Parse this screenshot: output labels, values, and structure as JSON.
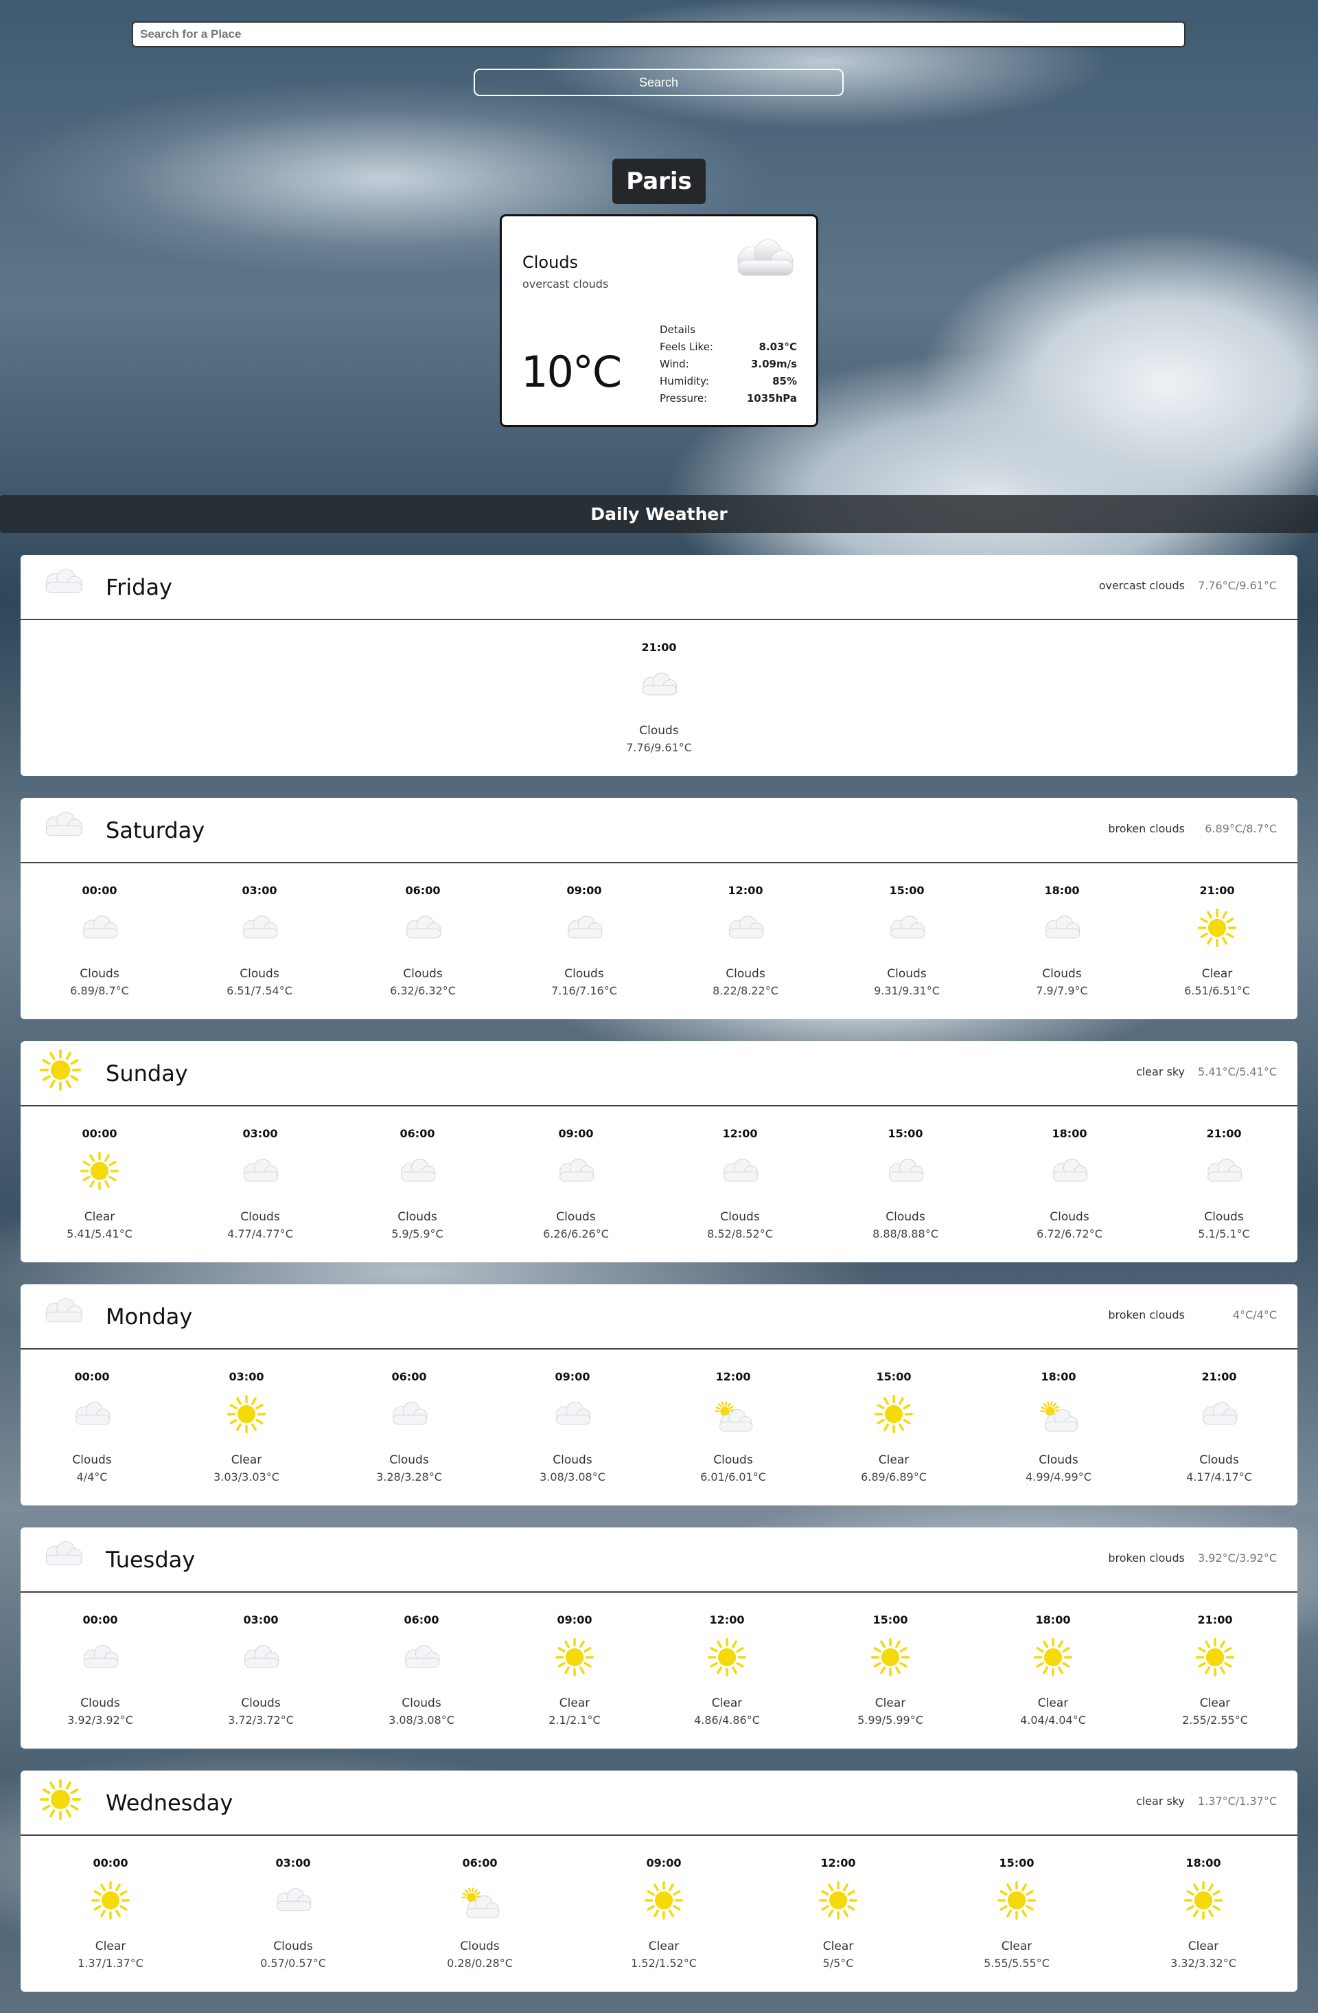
{
  "search": {
    "placeholder": "Search for a Place",
    "button_label": "Search"
  },
  "city": "Paris",
  "current": {
    "main": "Clouds",
    "description": "overcast clouds",
    "icon": "cloud-icon",
    "temp": "10°C",
    "details_label": "Details",
    "rows": [
      {
        "label": "Feels Like:",
        "value": "8.03°C"
      },
      {
        "label": "Wind:",
        "value": "3.09m/s"
      },
      {
        "label": "Humidity:",
        "value": "85%"
      },
      {
        "label": "Pressure:",
        "value": "1035hPa"
      }
    ]
  },
  "daily_title": "Daily Weather",
  "days": [
    {
      "name": "Friday",
      "icon": "cloud",
      "desc": "overcast clouds",
      "range": "7.76°C/9.61°C",
      "hours": [
        {
          "time": "21:00",
          "cond": "Clouds",
          "icon": "cloud",
          "range": "7.76/9.61°C"
        }
      ]
    },
    {
      "name": "Saturday",
      "icon": "cloud",
      "desc": "broken clouds",
      "range": "6.89°C/8.7°C",
      "hours": [
        {
          "time": "00:00",
          "cond": "Clouds",
          "icon": "cloud",
          "range": "6.89/8.7°C"
        },
        {
          "time": "03:00",
          "cond": "Clouds",
          "icon": "cloud",
          "range": "6.51/7.54°C"
        },
        {
          "time": "06:00",
          "cond": "Clouds",
          "icon": "cloud",
          "range": "6.32/6.32°C"
        },
        {
          "time": "09:00",
          "cond": "Clouds",
          "icon": "cloud",
          "range": "7.16/7.16°C"
        },
        {
          "time": "12:00",
          "cond": "Clouds",
          "icon": "cloud",
          "range": "8.22/8.22°C"
        },
        {
          "time": "15:00",
          "cond": "Clouds",
          "icon": "cloud",
          "range": "9.31/9.31°C"
        },
        {
          "time": "18:00",
          "cond": "Clouds",
          "icon": "cloud",
          "range": "7.9/7.9°C"
        },
        {
          "time": "21:00",
          "cond": "Clear",
          "icon": "sun",
          "range": "6.51/6.51°C"
        }
      ]
    },
    {
      "name": "Sunday",
      "icon": "sun",
      "desc": "clear sky",
      "range": "5.41°C/5.41°C",
      "hours": [
        {
          "time": "00:00",
          "cond": "Clear",
          "icon": "sun",
          "range": "5.41/5.41°C"
        },
        {
          "time": "03:00",
          "cond": "Clouds",
          "icon": "cloud",
          "range": "4.77/4.77°C"
        },
        {
          "time": "06:00",
          "cond": "Clouds",
          "icon": "cloud",
          "range": "5.9/5.9°C"
        },
        {
          "time": "09:00",
          "cond": "Clouds",
          "icon": "cloud",
          "range": "6.26/6.26°C"
        },
        {
          "time": "12:00",
          "cond": "Clouds",
          "icon": "cloud",
          "range": "8.52/8.52°C"
        },
        {
          "time": "15:00",
          "cond": "Clouds",
          "icon": "cloud",
          "range": "8.88/8.88°C"
        },
        {
          "time": "18:00",
          "cond": "Clouds",
          "icon": "cloud",
          "range": "6.72/6.72°C"
        },
        {
          "time": "21:00",
          "cond": "Clouds",
          "icon": "cloud",
          "range": "5.1/5.1°C"
        }
      ]
    },
    {
      "name": "Monday",
      "icon": "cloud",
      "desc": "broken clouds",
      "range": "4°C/4°C",
      "hours": [
        {
          "time": "00:00",
          "cond": "Clouds",
          "icon": "cloud",
          "range": "4/4°C"
        },
        {
          "time": "03:00",
          "cond": "Clear",
          "icon": "sun",
          "range": "3.03/3.03°C"
        },
        {
          "time": "06:00",
          "cond": "Clouds",
          "icon": "cloud",
          "range": "3.28/3.28°C"
        },
        {
          "time": "09:00",
          "cond": "Clouds",
          "icon": "cloud",
          "range": "3.08/3.08°C"
        },
        {
          "time": "12:00",
          "cond": "Clouds",
          "icon": "sun-cloud",
          "range": "6.01/6.01°C"
        },
        {
          "time": "15:00",
          "cond": "Clear",
          "icon": "sun",
          "range": "6.89/6.89°C"
        },
        {
          "time": "18:00",
          "cond": "Clouds",
          "icon": "sun-cloud",
          "range": "4.99/4.99°C"
        },
        {
          "time": "21:00",
          "cond": "Clouds",
          "icon": "cloud",
          "range": "4.17/4.17°C"
        }
      ]
    },
    {
      "name": "Tuesday",
      "icon": "cloud",
      "desc": "broken clouds",
      "range": "3.92°C/3.92°C",
      "hours": [
        {
          "time": "00:00",
          "cond": "Clouds",
          "icon": "cloud",
          "range": "3.92/3.92°C"
        },
        {
          "time": "03:00",
          "cond": "Clouds",
          "icon": "cloud",
          "range": "3.72/3.72°C"
        },
        {
          "time": "06:00",
          "cond": "Clouds",
          "icon": "cloud",
          "range": "3.08/3.08°C"
        },
        {
          "time": "09:00",
          "cond": "Clear",
          "icon": "sun",
          "range": "2.1/2.1°C"
        },
        {
          "time": "12:00",
          "cond": "Clear",
          "icon": "sun",
          "range": "4.86/4.86°C"
        },
        {
          "time": "15:00",
          "cond": "Clear",
          "icon": "sun",
          "range": "5.99/5.99°C"
        },
        {
          "time": "18:00",
          "cond": "Clear",
          "icon": "sun",
          "range": "4.04/4.04°C"
        },
        {
          "time": "21:00",
          "cond": "Clear",
          "icon": "sun",
          "range": "2.55/2.55°C"
        }
      ]
    },
    {
      "name": "Wednesday",
      "icon": "sun",
      "desc": "clear sky",
      "range": "1.37°C/1.37°C",
      "hours": [
        {
          "time": "00:00",
          "cond": "Clear",
          "icon": "sun",
          "range": "1.37/1.37°C"
        },
        {
          "time": "03:00",
          "cond": "Clouds",
          "icon": "cloud",
          "range": "0.57/0.57°C"
        },
        {
          "time": "06:00",
          "cond": "Clouds",
          "icon": "sun-cloud",
          "range": "0.28/0.28°C"
        },
        {
          "time": "09:00",
          "cond": "Clear",
          "icon": "sun",
          "range": "1.52/1.52°C"
        },
        {
          "time": "12:00",
          "cond": "Clear",
          "icon": "sun",
          "range": "5/5°C"
        },
        {
          "time": "15:00",
          "cond": "Clear",
          "icon": "sun",
          "range": "5.55/5.55°C"
        },
        {
          "time": "18:00",
          "cond": "Clear",
          "icon": "sun",
          "range": "3.32/3.32°C"
        }
      ]
    }
  ]
}
